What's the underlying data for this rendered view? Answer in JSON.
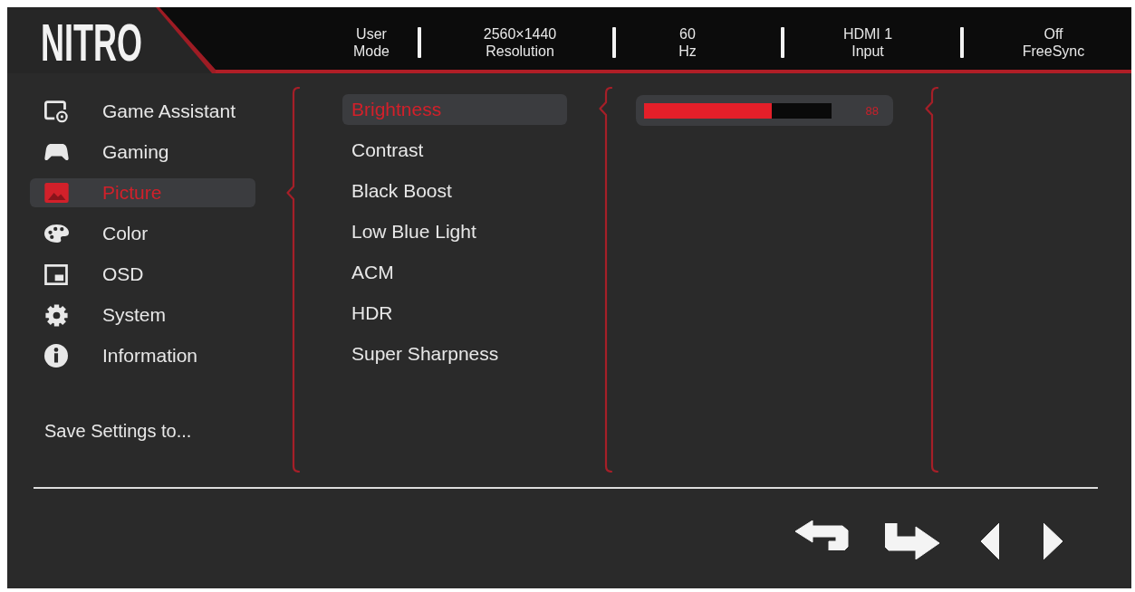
{
  "header": {
    "logo": "NITRO",
    "status": [
      {
        "value": "User",
        "label": "Mode"
      },
      {
        "value": "2560×1440",
        "label": "Resolution"
      },
      {
        "value": "60",
        "label": "Hz"
      },
      {
        "value": "HDMI 1",
        "label": "Input"
      },
      {
        "value": "Off",
        "label": "FreeSync"
      }
    ]
  },
  "menu": {
    "items": [
      {
        "label": "Game Assistant",
        "selected": false
      },
      {
        "label": "Gaming",
        "selected": false
      },
      {
        "label": "Picture",
        "selected": true
      },
      {
        "label": "Color",
        "selected": false
      },
      {
        "label": "OSD",
        "selected": false
      },
      {
        "label": "System",
        "selected": false
      },
      {
        "label": "Information",
        "selected": false
      }
    ],
    "save_settings": "Save Settings to..."
  },
  "submenu": {
    "items": [
      {
        "label": "Brightness",
        "selected": true
      },
      {
        "label": "Contrast",
        "selected": false
      },
      {
        "label": "Black Boost",
        "selected": false
      },
      {
        "label": "Low Blue Light",
        "selected": false
      },
      {
        "label": "ACM",
        "selected": false
      },
      {
        "label": "HDR",
        "selected": false
      },
      {
        "label": "Super Sharpness",
        "selected": false
      }
    ]
  },
  "value_slider": {
    "level": 0.68,
    "reading": "88"
  }
}
